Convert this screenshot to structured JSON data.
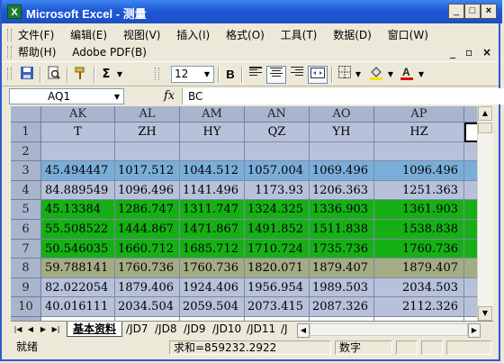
{
  "window": {
    "title": "Microsoft Excel - 测量",
    "min": "_",
    "max": "□",
    "close": "×"
  },
  "menu": {
    "row1": [
      "文件(F)",
      "编辑(E)",
      "视图(V)",
      "插入(I)",
      "格式(O)",
      "工具(T)",
      "数据(D)",
      "窗口(W)"
    ],
    "row2": [
      "帮助(H)",
      "Adobe PDF(B)"
    ],
    "doc_min": "_",
    "doc_restore": "▫",
    "doc_close": "×"
  },
  "toolbar": {
    "sum": "Σ",
    "font_size": "12",
    "bold": "B"
  },
  "formula_bar": {
    "name_box": "AQ1",
    "fx": "fx",
    "value": "BC"
  },
  "columns": [
    "AK",
    "AL",
    "AM",
    "AN",
    "AO",
    "AP"
  ],
  "rows": [
    {
      "num": "1",
      "cells": [
        "T",
        "ZH",
        "HY",
        "QZ",
        "YH",
        "HZ"
      ]
    },
    {
      "num": "2",
      "cells": [
        "",
        "",
        "",
        "",
        "",
        ""
      ]
    },
    {
      "num": "3",
      "cells": [
        "45.494447",
        "1017.512",
        "1044.512",
        "1057.004",
        "1069.496",
        "1096.496"
      ]
    },
    {
      "num": "4",
      "cells": [
        "84.889549",
        "1096.496",
        "1141.496",
        "1173.93",
        "1206.363",
        "1251.363"
      ]
    },
    {
      "num": "5",
      "cells": [
        "45.13384",
        "1286.747",
        "1311.747",
        "1324.325",
        "1336.903",
        "1361.903"
      ]
    },
    {
      "num": "6",
      "cells": [
        "55.508522",
        "1444.867",
        "1471.867",
        "1491.852",
        "1511.838",
        "1538.838"
      ]
    },
    {
      "num": "7",
      "cells": [
        "50.546035",
        "1660.712",
        "1685.712",
        "1710.724",
        "1735.736",
        "1760.736"
      ]
    },
    {
      "num": "8",
      "cells": [
        "59.788141",
        "1760.736",
        "1760.736",
        "1820.071",
        "1879.407",
        "1879.407"
      ]
    },
    {
      "num": "9",
      "cells": [
        "82.022054",
        "1879.406",
        "1924.406",
        "1956.954",
        "1989.503",
        "2034.503"
      ]
    },
    {
      "num": "10",
      "cells": [
        "40.016111",
        "2034.504",
        "2059.504",
        "2073.415",
        "2087.326",
        "2112.326"
      ]
    },
    {
      "num": "11",
      "cells": [
        "",
        "",
        "",
        "",
        "",
        ""
      ]
    }
  ],
  "row_colors": {
    "1": "#b8c1da",
    "2": "#b8c1da",
    "3": "#7aaed8",
    "4": "#b8c1da",
    "5": "#16b016",
    "6": "#16b016",
    "7": "#16b016",
    "8": "#a3ad84",
    "9": "#b8c1da",
    "10": "#b8c1da",
    "11": "#ffffff"
  },
  "tabs": [
    "基本资料",
    "JD7",
    "JD8",
    "JD9",
    "JD10",
    "JD11",
    "J"
  ],
  "status": {
    "ready": "就绪",
    "sum": "求和=859232.2922",
    "mode": "数字"
  }
}
